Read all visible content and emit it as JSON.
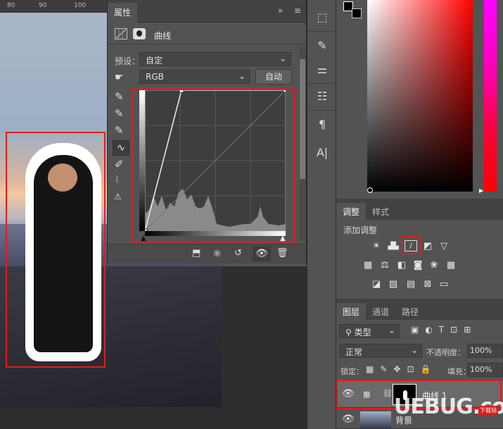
{
  "ruler": {
    "labels": [
      "80",
      "90",
      "100"
    ]
  },
  "properties": {
    "tab": "属性",
    "collapse_glyph": "»",
    "menu_glyph": "≡",
    "header_title": "曲线",
    "preset_label": "预设：",
    "preset_value": "自定",
    "channel_value": "RGB",
    "auto_label": "自动"
  },
  "adjustments": {
    "tabs": [
      "调整",
      "样式"
    ],
    "add_label": "添加调整"
  },
  "layers": {
    "tabs": [
      "图层",
      "通道",
      "路径"
    ],
    "filter_label": "类型",
    "blend_mode": "正常",
    "opacity_label": "不透明度：",
    "opacity_value": "100%",
    "lock_label": "锁定：",
    "fill_label": "填充：",
    "fill_value": "100%",
    "items": [
      {
        "name": "曲线 1"
      },
      {
        "name": "背景"
      }
    ]
  },
  "watermark": {
    "text": "UEBUG.com",
    "sub": "下载站"
  },
  "colors": {
    "accent_red": "#e01d1d",
    "panel": "#535353",
    "panel_dark": "#424242",
    "selected_layer": "#6a6a6a"
  }
}
